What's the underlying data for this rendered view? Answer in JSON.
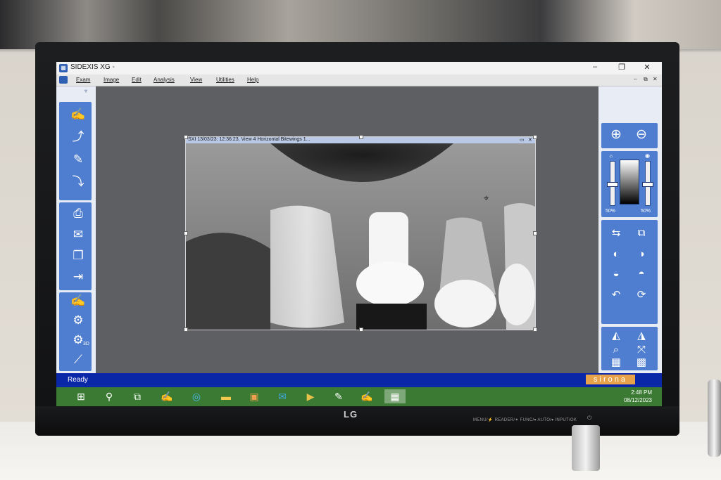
{
  "app": {
    "title": "SIDEXIS XG -",
    "icon": "sidexis-app-icon"
  },
  "window_controls": {
    "minimize": "–",
    "maximize": "❐",
    "close": "✕"
  },
  "child_window_controls": {
    "minimize": "–",
    "restore": "⧉",
    "close": "✕"
  },
  "menu": {
    "items": [
      "Exam",
      "Image",
      "Edit",
      "Analysis",
      "View",
      "Utilities",
      "Help"
    ]
  },
  "left_toolbar": {
    "collapse_glyph": "▿",
    "buttons": [
      {
        "icon": "patient-select-icon",
        "glyph": "✍"
      },
      {
        "icon": "export-image-icon",
        "glyph": "⤴"
      },
      {
        "icon": "edit-image-icon",
        "glyph": "✎"
      },
      {
        "icon": "import-image-icon",
        "glyph": "⤵"
      },
      {
        "icon": "print-icon",
        "glyph": "⎙"
      },
      {
        "icon": "mail-icon",
        "glyph": "✉"
      },
      {
        "icon": "copy-icon",
        "glyph": "❐"
      },
      {
        "icon": "exit-icon",
        "glyph": "⇥"
      },
      {
        "icon": "patient-select-2-icon",
        "glyph": "✍"
      },
      {
        "icon": "xray-device-icon",
        "glyph": "⚙"
      },
      {
        "icon": "xray-3d-icon",
        "glyph": "⚙"
      },
      {
        "icon": "probe-icon",
        "glyph": "⟋"
      }
    ],
    "label_3d": "3D"
  },
  "right_toolbar": {
    "zoom_in": "⊕",
    "zoom_out": "⊖",
    "brightness_icon": "☼",
    "contrast_icon": "◉",
    "brightness_percent": "50%",
    "contrast_percent": "50%",
    "brightness_level": 0.5,
    "contrast_level": 0.5,
    "buttons": [
      {
        "icon": "mirror-icon",
        "glyph": "⇆"
      },
      {
        "icon": "split-view-icon",
        "glyph": "⧉"
      },
      {
        "icon": "filter-a-icon",
        "glyph": "◐"
      },
      {
        "icon": "filter-b-icon",
        "glyph": "◑"
      },
      {
        "icon": "filter-c-icon",
        "glyph": "◒"
      },
      {
        "icon": "filter-d-icon",
        "glyph": "◓"
      },
      {
        "icon": "undo-icon",
        "glyph": "↶"
      },
      {
        "icon": "rotate-icon",
        "glyph": "⟳"
      },
      {
        "icon": "measure-angle-icon",
        "glyph": "◭"
      },
      {
        "icon": "measure-length-icon",
        "glyph": "◮"
      },
      {
        "icon": "magnifier-icon",
        "glyph": "⌕"
      },
      {
        "icon": "fit-screen-icon",
        "glyph": "⤧"
      },
      {
        "icon": "grid-1-icon",
        "glyph": "▦"
      },
      {
        "icon": "grid-2-icon",
        "glyph": "▩"
      }
    ]
  },
  "image_window": {
    "title": "SXI 13/03/23: 12:36:23, View 4 Horizontal Bitewings 1...",
    "controls": {
      "minimize": "▭",
      "close": "✕"
    }
  },
  "status": {
    "text": "Ready",
    "brand": "sirona"
  },
  "taskbar": {
    "items": [
      {
        "icon": "windows-start-icon",
        "glyph": "⊞"
      },
      {
        "icon": "search-icon",
        "glyph": "⚲"
      },
      {
        "icon": "task-view-icon",
        "glyph": "⧉"
      },
      {
        "icon": "sidexis-taskbar-icon",
        "glyph": "✍"
      },
      {
        "icon": "edge-browser-icon",
        "glyph": "◎"
      },
      {
        "icon": "file-explorer-icon",
        "glyph": "▬"
      },
      {
        "icon": "store-icon",
        "glyph": "▣"
      },
      {
        "icon": "mail-app-icon",
        "glyph": "✉"
      },
      {
        "icon": "media-icon",
        "glyph": "▶"
      },
      {
        "icon": "notes-icon",
        "glyph": "✎"
      },
      {
        "icon": "sidexis-2-taskbar-icon",
        "glyph": "✍"
      },
      {
        "icon": "xray-viewer-taskbar-icon",
        "glyph": "▦"
      }
    ],
    "active_index": 11,
    "time": "2:48 PM",
    "date": "08/12/2023"
  },
  "monitor": {
    "brand": "LG",
    "buttons_label": "MENU/⚡ READER/✦ FUNC/▾ AUTO/▾ INPUT/OK",
    "power_glyph": "⏻"
  }
}
